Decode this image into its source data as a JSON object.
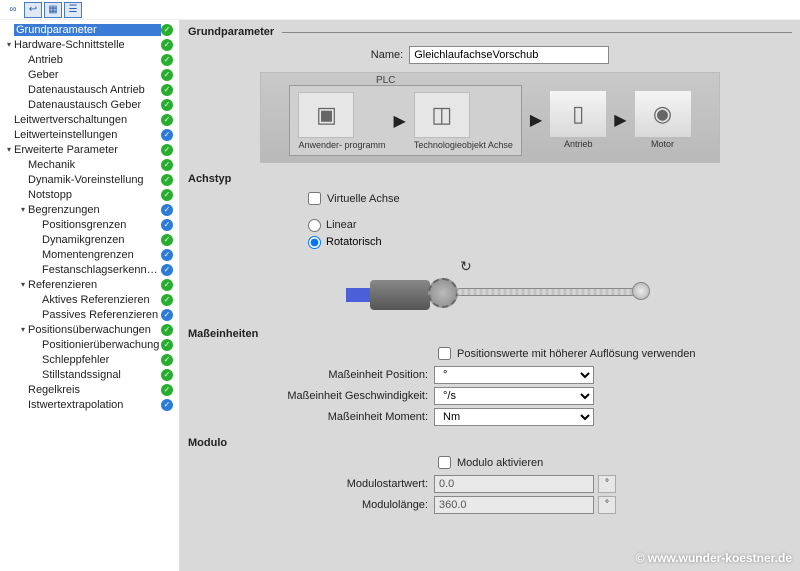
{
  "toolbar": {
    "icons": [
      "link-icon",
      "back-icon",
      "tiles-icon",
      "list-icon"
    ]
  },
  "tree": [
    {
      "label": "Grundparameter",
      "level": 0,
      "arrow": "",
      "status": "green",
      "selected": true
    },
    {
      "label": "Hardware-Schnittstelle",
      "level": 0,
      "arrow": "▾",
      "status": "green"
    },
    {
      "label": "Antrieb",
      "level": 1,
      "arrow": "",
      "status": "green"
    },
    {
      "label": "Geber",
      "level": 1,
      "arrow": "",
      "status": "green"
    },
    {
      "label": "Datenaustausch Antrieb",
      "level": 1,
      "arrow": "",
      "status": "green"
    },
    {
      "label": "Datenaustausch Geber",
      "level": 1,
      "arrow": "",
      "status": "green"
    },
    {
      "label": "Leitwertverschaltungen",
      "level": 0,
      "arrow": "",
      "status": "green"
    },
    {
      "label": "Leitwerteinstellungen",
      "level": 0,
      "arrow": "",
      "status": "blue"
    },
    {
      "label": "Erweiterte Parameter",
      "level": 0,
      "arrow": "▾",
      "status": "green"
    },
    {
      "label": "Mechanik",
      "level": 1,
      "arrow": "",
      "status": "green"
    },
    {
      "label": "Dynamik-Voreinstellung",
      "level": 1,
      "arrow": "",
      "status": "green"
    },
    {
      "label": "Notstopp",
      "level": 1,
      "arrow": "",
      "status": "green"
    },
    {
      "label": "Begrenzungen",
      "level": 1,
      "arrow": "▾",
      "status": "blue"
    },
    {
      "label": "Positionsgrenzen",
      "level": 2,
      "arrow": "",
      "status": "blue"
    },
    {
      "label": "Dynamikgrenzen",
      "level": 2,
      "arrow": "",
      "status": "green"
    },
    {
      "label": "Momentengrenzen",
      "level": 2,
      "arrow": "",
      "status": "blue"
    },
    {
      "label": "Festanschlagserkennung",
      "level": 2,
      "arrow": "",
      "status": "blue"
    },
    {
      "label": "Referenzieren",
      "level": 1,
      "arrow": "▾",
      "status": "green"
    },
    {
      "label": "Aktives Referenzieren",
      "level": 2,
      "arrow": "",
      "status": "green"
    },
    {
      "label": "Passives Referenzieren",
      "level": 2,
      "arrow": "",
      "status": "blue"
    },
    {
      "label": "Positionsüberwachungen",
      "level": 1,
      "arrow": "▾",
      "status": "green"
    },
    {
      "label": "Positionierüberwachung",
      "level": 2,
      "arrow": "",
      "status": "green"
    },
    {
      "label": "Schleppfehler",
      "level": 2,
      "arrow": "",
      "status": "green"
    },
    {
      "label": "Stillstandssignal",
      "level": 2,
      "arrow": "",
      "status": "green"
    },
    {
      "label": "Regelkreis",
      "level": 1,
      "arrow": "",
      "status": "green"
    },
    {
      "label": "Istwertextrapolation",
      "level": 1,
      "arrow": "",
      "status": "blue"
    }
  ],
  "content": {
    "header": "Grundparameter",
    "name_label": "Name:",
    "name_value": "GleichlaufachseVorschub",
    "diagram": {
      "plc": "PLC",
      "items": [
        "Anwender-\nprogramm",
        "Technologieobjekt\nAchse",
        "Antrieb",
        "Motor"
      ]
    },
    "achstyp": {
      "title": "Achstyp",
      "virtual": "Virtuelle Achse",
      "linear": "Linear",
      "rotatorisch": "Rotatorisch",
      "selected": "rotatorisch"
    },
    "units": {
      "title": "Maßeinheiten",
      "hires": "Positionswerte mit höherer Auflösung verwenden",
      "pos_label": "Maßeinheit Position:",
      "pos_value": "°",
      "vel_label": "Maßeinheit Geschwindigkeit:",
      "vel_value": "°/s",
      "mom_label": "Maßeinheit Moment:",
      "mom_value": "Nm"
    },
    "modulo": {
      "title": "Modulo",
      "activate": "Modulo aktivieren",
      "start_label": "Modulostartwert:",
      "start_value": "0.0",
      "len_label": "Modulolänge:",
      "len_value": "360.0",
      "unit": "°"
    }
  },
  "watermark": "© www.wunder-koestner.de"
}
